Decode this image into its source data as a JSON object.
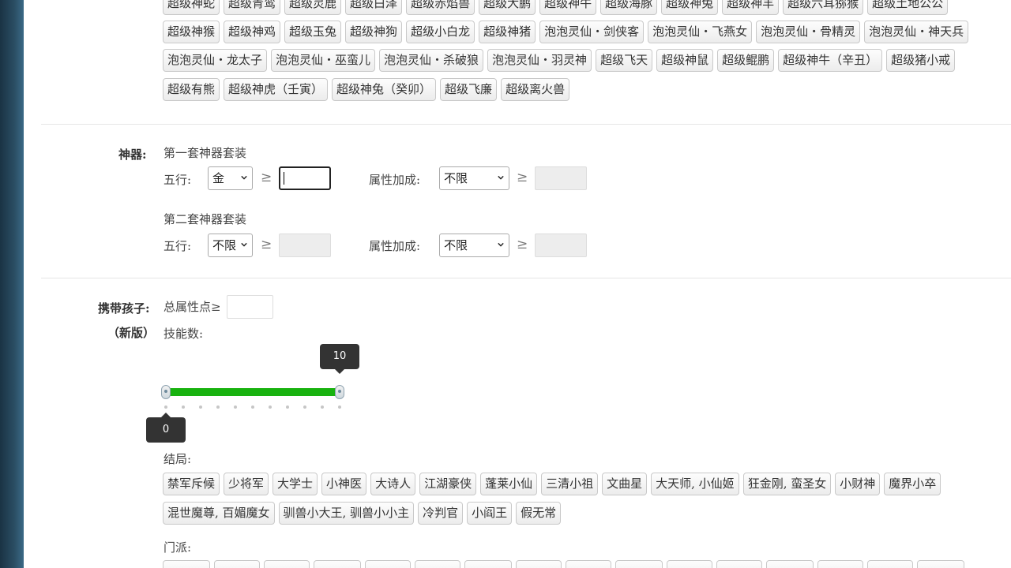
{
  "pets": {
    "row1": [
      "超级神蛇",
      "超级青鸾",
      "超级灵鹿",
      "超级白泽",
      "超级赤焰兽",
      "超级大鹏",
      "超级神牛",
      "超级海豚",
      "超级神兔",
      "超级神羊",
      "超级六耳猕猴",
      "超级土地公公"
    ],
    "row2": [
      "超级神猴",
      "超级神鸡",
      "超级玉兔",
      "超级神狗",
      "超级小白龙",
      "超级神猪",
      "泡泡灵仙・剑侠客",
      "泡泡灵仙・飞燕女",
      "泡泡灵仙・骨精灵",
      "泡泡灵仙・神天兵"
    ],
    "row3": [
      "泡泡灵仙・龙太子",
      "泡泡灵仙・巫蛮儿",
      "泡泡灵仙・杀破狼",
      "泡泡灵仙・羽灵神",
      "超级飞天",
      "超级神鼠",
      "超级鲲鹏",
      "超级神牛（辛丑）",
      "超级猪小戒"
    ],
    "row4": [
      "超级有熊",
      "超级神虎（壬寅）",
      "超级神兔（癸卯）",
      "超级飞廉",
      "超级离火兽"
    ]
  },
  "artifact": {
    "label": "神器:",
    "set1_title": "第一套神器套装",
    "set2_title": "第二套神器套装",
    "wuxing_label": "五行:",
    "attr_label": "属性加成:",
    "ge": "≥",
    "set1_wuxing": "金",
    "set1_attr": "不限",
    "set2_wuxing": "不限",
    "set2_attr": "不限"
  },
  "child": {
    "label_line1": "携带孩子:",
    "label_line2": "（新版）",
    "total_attr_label": "总属性点≥",
    "skill_label": "技能数:",
    "slider_min": 0,
    "slider_max": 10,
    "slider_low": 0,
    "slider_high": 10,
    "tooltip_low": "0",
    "tooltip_high": "10",
    "ending_label": "结局:",
    "endings_row1": [
      "禁军斥候",
      "少将军",
      "大学士",
      "小神医",
      "大诗人",
      "江湖豪侠",
      "蓬莱小仙",
      "三清小祖",
      "文曲星",
      "大天师, 小仙姬",
      "狂金刚, 蛮圣女",
      "小财神",
      "魔界小卒"
    ],
    "endings_row2": [
      "混世魔尊, 百媚魔女",
      "驯兽小大王, 驯兽小小主",
      "冷判官",
      "小阎王",
      "假无常"
    ],
    "school_label": "门派:"
  },
  "colors": {
    "slider_fill": "#18b20f"
  }
}
